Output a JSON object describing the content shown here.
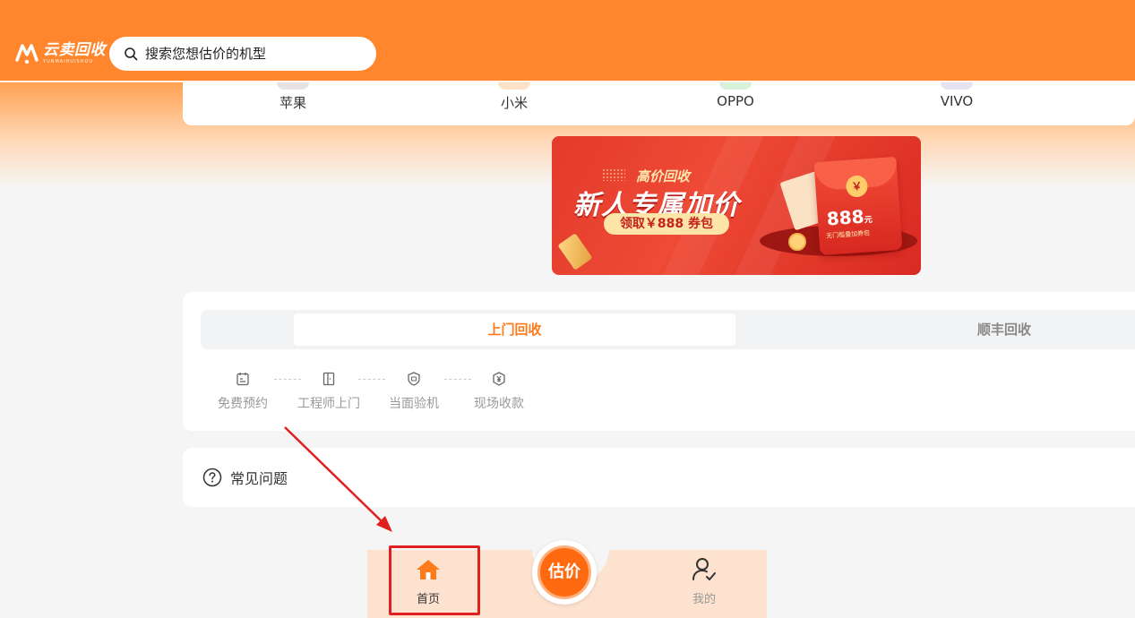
{
  "header": {
    "logo_text": "云卖回收",
    "logo_sub": "YUNMAIHUISHOU",
    "search_placeholder": "搜索您想估价的机型"
  },
  "brands": [
    {
      "label": "苹果",
      "color": "#e8e2e2"
    },
    {
      "label": "小米",
      "color": "#fde2c8"
    },
    {
      "label": "OPPO",
      "color": "#d7f2d9"
    },
    {
      "label": "VIVO",
      "color": "#e6e2f2"
    }
  ],
  "banner": {
    "title_small": "高价回收",
    "title": "新人专属加价",
    "pill": "领取￥888 券包",
    "seal": "￥",
    "amount": "888",
    "amount_unit": "元",
    "amount_sub": "无门槛叠加券包"
  },
  "service": {
    "tabs": [
      {
        "label": "上门回收",
        "active": true
      },
      {
        "label": "顺丰回收",
        "active": false
      }
    ],
    "steps": [
      {
        "label": "免费预约",
        "icon": "calendar-icon"
      },
      {
        "label": "工程师上门",
        "icon": "door-icon"
      },
      {
        "label": "当面验机",
        "icon": "shield-check-icon"
      },
      {
        "label": "现场收款",
        "icon": "yuan-shield-icon"
      }
    ]
  },
  "faq": {
    "label": "常见问题",
    "icon": "question-circle-icon"
  },
  "tabbar": {
    "home_label": "首页",
    "center_label": "估价",
    "mine_label": "我的",
    "accent": "#ff7a1a"
  },
  "annotation": {
    "color": "#e02020"
  }
}
